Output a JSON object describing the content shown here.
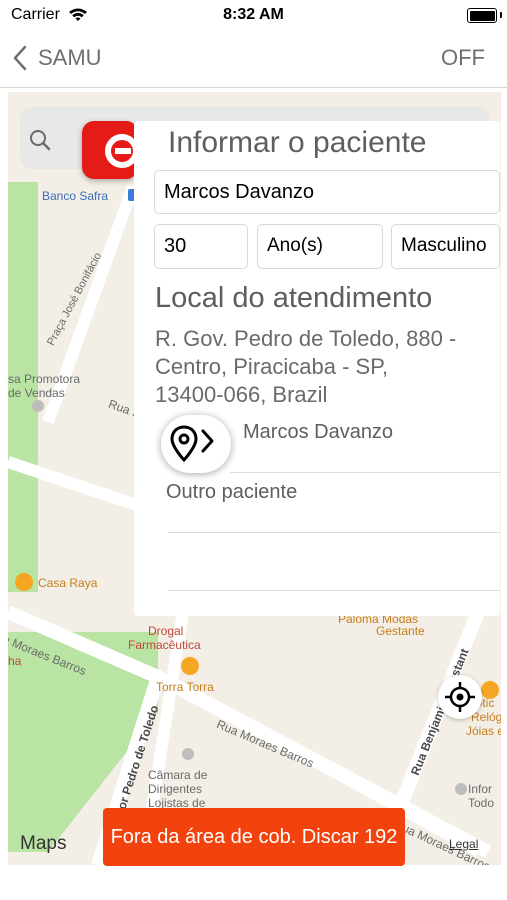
{
  "status_bar": {
    "carrier": "Carrier",
    "time": "8:32 AM"
  },
  "nav": {
    "back_title": "SAMU",
    "right_action": "OFF"
  },
  "map": {
    "labels": [
      "Banco Safra",
      "Praça José Bonifácio",
      "sa Promotora",
      "de Vendas",
      "Rua S",
      "Casa Raya",
      "Drogal",
      "Farmacêutica",
      "Torra Torra",
      "Paloma Modas",
      "Gestante",
      "Rua Benjamin Constant",
      "a Moraes Barros",
      "ha",
      "Rua Moraes Barros",
      "nador Pedro de Toledo",
      "Câmara de",
      "Dirigentes",
      "Lojistas de",
      "Ótic",
      "Relógi",
      "Jóias e C",
      "Infor",
      "Todo",
      "Rua Moraes Barros"
    ],
    "brand": "Maps",
    "legal": "Legal"
  },
  "form": {
    "title": "Informar o paciente",
    "patient_name": "Marcos Davanzo",
    "age": "30",
    "age_unit": "Ano(s)",
    "gender": "Masculino",
    "location_title": "Local do atendimento",
    "address_lines": [
      "R. Gov. Pedro de Toledo, 880 -",
      "Centro, Piracicaba - SP,",
      "13400-066, Brazil"
    ],
    "patients": [
      "Marcos Davanzo",
      "Outro paciente"
    ]
  },
  "banner": {
    "text": "Fora da área de cob. Discar 192"
  },
  "colors": {
    "banner": "#f2420e",
    "logo": "#e41b17",
    "map_bg": "#f3efe6",
    "park": "#b9e4a3",
    "poi_orange": "#f5a623"
  }
}
